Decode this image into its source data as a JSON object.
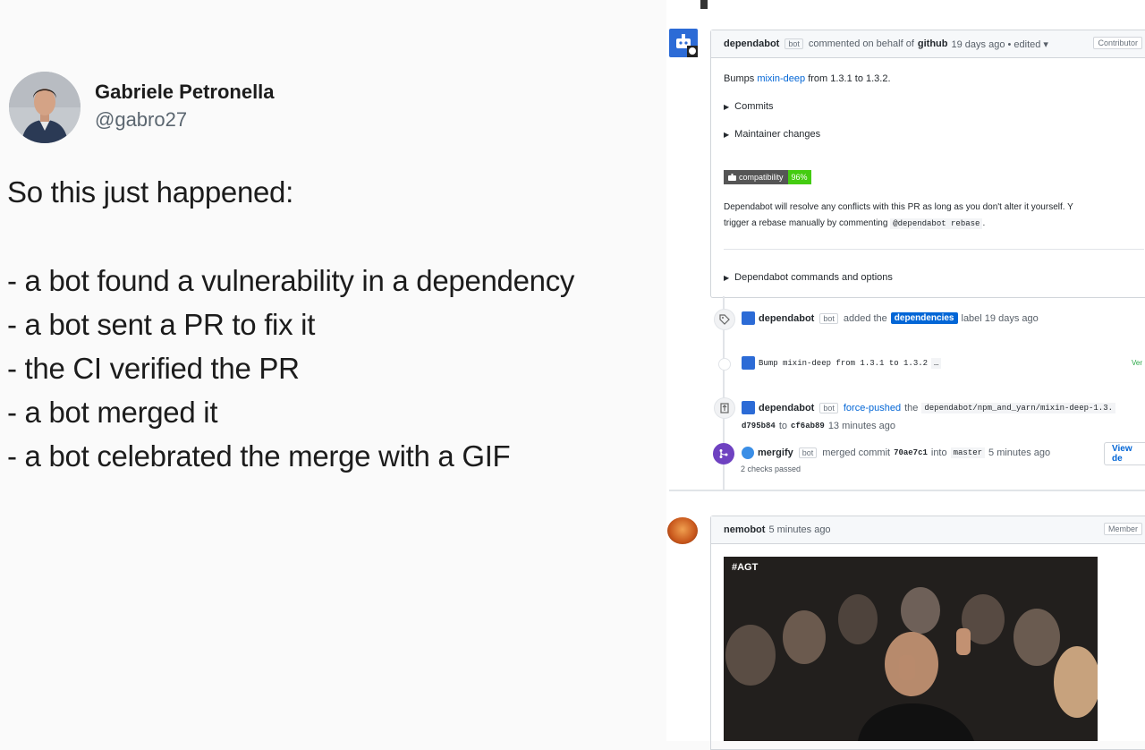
{
  "tweet": {
    "author_name": "Gabriele Petronella",
    "handle": "@gabro27",
    "lines": [
      "So this just happened:",
      "",
      "- a bot found a vulnerability in a dependency",
      "- a bot sent a PR to fix it",
      "- the CI verified the PR",
      "- a bot merged it",
      "- a bot celebrated the merge with a GIF"
    ]
  },
  "github": {
    "comment": {
      "author": "dependabot",
      "bot_tag": "bot",
      "action": "commented on behalf of",
      "org": "github",
      "time": "19 days ago • edited ▾",
      "role": "Contributor",
      "bumps_prefix": "Bumps",
      "package": "mixin-deep",
      "bumps_suffix": "from 1.3.1 to 1.3.2.",
      "commits": "Commits",
      "maintainer_changes": "Maintainer changes",
      "badge_label": "compatibility",
      "badge_value": "96%",
      "resolve_text_1": "Dependabot will resolve any conflicts with this PR as long as you don't alter it yourself. Y",
      "resolve_text_2": "trigger a rebase manually by commenting",
      "rebase_cmd": "@dependabot rebase",
      "resolve_end": ".",
      "commands": "Dependabot commands and options"
    },
    "events": {
      "label_event": {
        "author": "dependabot",
        "bot_tag": "bot",
        "text": "added the",
        "label": "dependencies",
        "suffix": "label 19 days ago"
      },
      "commit_event": {
        "message": "Bump mixin-deep from 1.3.1 to 1.3.2",
        "ellipsis": "…",
        "verified": "Ver"
      },
      "push_event": {
        "author": "dependabot",
        "bot_tag": "bot",
        "action": "force-pushed",
        "the": "the",
        "branch": "dependabot/npm_and_yarn/mixin-deep-1.3.",
        "from_sha": "d795b84",
        "to": "to",
        "to_sha": "cf6ab89",
        "time": "13 minutes ago"
      },
      "merge_event": {
        "author": "mergify",
        "bot_tag": "bot",
        "action": "merged commit",
        "sha": "70ae7c1",
        "into": "into",
        "branch": "master",
        "time": "5 minutes ago",
        "checks": "2 checks passed",
        "view_button": "View de"
      }
    },
    "nemo_comment": {
      "author": "nemobot",
      "time": "5 minutes ago",
      "role": "Member",
      "gif_tag": "#AGT"
    }
  }
}
